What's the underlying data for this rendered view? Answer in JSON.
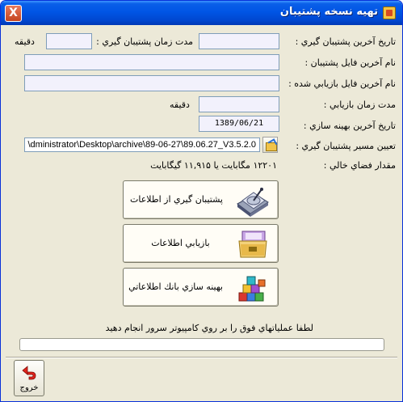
{
  "window": {
    "title": "تهيه نسخه پشتيبان",
    "close_label": "X"
  },
  "fields": {
    "last_backup_date_label": "تاريخ آخرين پشتيبان گيري :",
    "last_backup_date_value": "",
    "backup_duration_label": "مدت زمان پشتيبان گيري :",
    "backup_duration_value": "",
    "backup_duration_unit": "دقيقه",
    "last_backup_file_label": "نام آخرين فايل پشتيبان :",
    "last_backup_file_value": "",
    "last_restore_file_label": "نام آخرين فايل بازيابي شده :",
    "last_restore_file_value": "",
    "restore_duration_label": "مدت زمان بازيابي :",
    "restore_duration_value": "",
    "restore_duration_unit": "دقيقه",
    "last_optimize_date_label": "تاريخ آخرين بهينه سازي :",
    "last_optimize_date_value": "1389/06/21",
    "backup_path_label": "تعيين مسير پشتيبان گيري :",
    "backup_path_value": "dministrator\\Desktop\\archive\\89-06-27\\89.06.27_V3.5.2.0\\",
    "free_space_label": "مقدار فضاي خالي :",
    "free_space_value": "۱۲۲۰۱ مگابايت   يا  ۱۱,۹۱۵ گيگابايت"
  },
  "buttons": {
    "backup_label": "پشتيبان گيري از اطلاعات",
    "restore_label": "بازيابي اطلاعات",
    "optimize_label": "بهينه سازي بانك اطلاعاتي",
    "exit_label": "خروج"
  },
  "status": {
    "message": "لطفا عملياتهاي فوق را بر روي كامپيوتر سرور انجام دهيد",
    "progress": 0
  },
  "icons": {
    "title": "app-icon",
    "backup": "hard-drive-icon",
    "restore": "folder-box-icon",
    "optimize": "blocks-icon",
    "browse": "folder-browse-icon",
    "exit": "exit-arrow-icon"
  },
  "colors": {
    "titlebar": "#0055e5",
    "window_bg": "#ece9d8",
    "field_bg": "#f2f1fc",
    "field_border": "#7f9db9"
  }
}
